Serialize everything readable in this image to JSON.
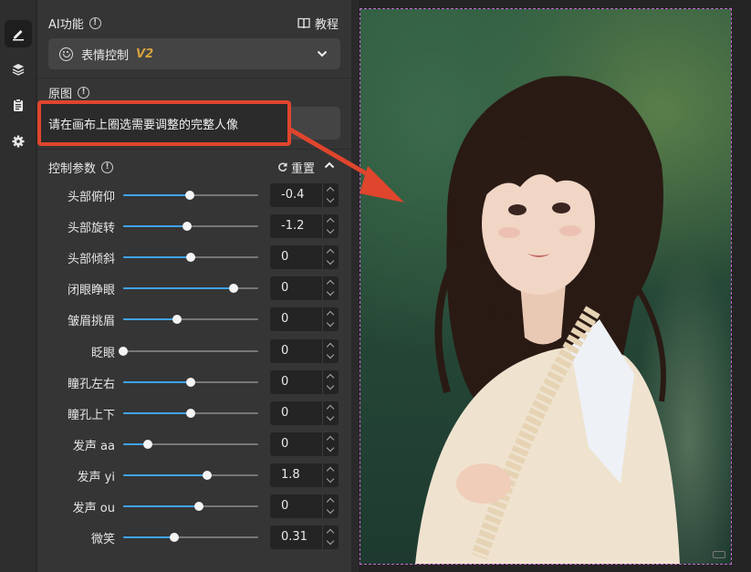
{
  "ai_function": {
    "title": "AI功能",
    "tutorial": "教程",
    "selected": "表情控制",
    "version": "V2"
  },
  "origin": {
    "title": "原图",
    "hint": "请在画布上圈选需要调整的完整人像"
  },
  "controls": {
    "title": "控制参数",
    "reset": "重置",
    "params": [
      {
        "label": "头部俯仰",
        "value": "-0.4",
        "fraction": 0.49
      },
      {
        "label": "头部旋转",
        "value": "-1.2",
        "fraction": 0.47
      },
      {
        "label": "头部倾斜",
        "value": "0",
        "fraction": 0.5
      },
      {
        "label": "闭眼睁眼",
        "value": "0",
        "fraction": 0.82
      },
      {
        "label": "皱眉挑眉",
        "value": "0",
        "fraction": 0.4
      },
      {
        "label": "眨眼",
        "value": "0",
        "fraction": 0.0
      },
      {
        "label": "瞳孔左右",
        "value": "0",
        "fraction": 0.5
      },
      {
        "label": "瞳孔上下",
        "value": "0",
        "fraction": 0.5
      },
      {
        "label": "发声 aa",
        "value": "0",
        "fraction": 0.18
      },
      {
        "label": "发声 yi",
        "value": "1.8",
        "fraction": 0.62
      },
      {
        "label": "发声 ou",
        "value": "0",
        "fraction": 0.56
      },
      {
        "label": "微笑",
        "value": "0.31",
        "fraction": 0.38
      }
    ]
  },
  "colors": {
    "accent": "#3fa3f0",
    "highlight": "#e0452d",
    "version": "#d6a23c"
  },
  "icons": [
    "edit-icon",
    "layers-icon",
    "clipboard-icon",
    "settings-icon",
    "info-icon",
    "book-icon",
    "smile-icon",
    "chevron-down-icon",
    "refresh-icon",
    "chevron-up-icon"
  ]
}
